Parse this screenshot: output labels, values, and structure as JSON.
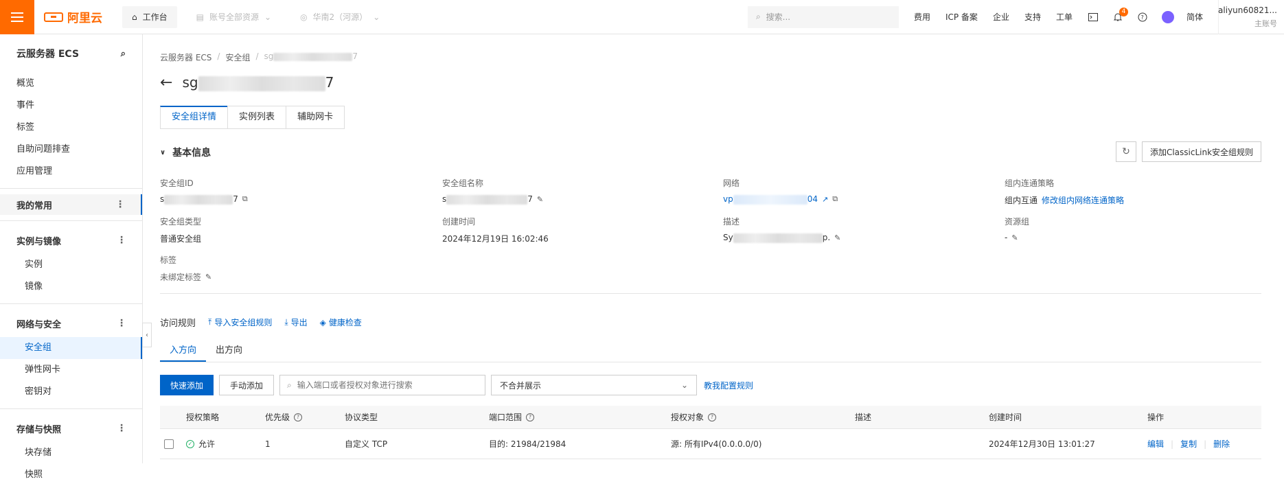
{
  "topbar": {
    "logo_text": "阿里云",
    "workbench": "工作台",
    "account_resources": "账号全部资源",
    "region": "华南2（河源）",
    "search_placeholder": "搜索...",
    "links": [
      "费用",
      "ICP 备案",
      "企业",
      "支持",
      "工单"
    ],
    "notification_count": "4",
    "lang": "简体",
    "account_name": "aliyun60821...",
    "account_role": "主账号"
  },
  "sidebar": {
    "title": "云服务器 ECS",
    "items_top": [
      "概览",
      "事件",
      "标签",
      "自助问题排查",
      "应用管理"
    ],
    "mine": "我的常用",
    "groups": [
      {
        "label": "实例与镜像",
        "items": [
          "实例",
          "镜像"
        ]
      },
      {
        "label": "网络与安全",
        "items": [
          "安全组",
          "弹性网卡",
          "密钥对"
        ]
      },
      {
        "label": "存储与快照",
        "items": [
          "块存储",
          "快照"
        ]
      }
    ]
  },
  "breadcrumb": {
    "a": "云服务器 ECS",
    "b": "安全组",
    "c_prefix": "sg",
    "c_suffix": "7"
  },
  "page_title": {
    "prefix": "sg",
    "suffix": "7"
  },
  "tabs": [
    "安全组详情",
    "实例列表",
    "辅助网卡"
  ],
  "basic_info": {
    "heading": "基本信息",
    "classic_btn": "添加ClassicLink安全组规则",
    "fields": {
      "sg_id": {
        "label": "安全组ID",
        "prefix": "s",
        "suffix": "7"
      },
      "sg_name": {
        "label": "安全组名称",
        "prefix": "s",
        "suffix": "7"
      },
      "network": {
        "label": "网络",
        "prefix": "vp",
        "suffix": "04"
      },
      "intra_policy": {
        "label": "组内连通策略",
        "value": "组内互通",
        "action": "修改组内网络连通策略"
      },
      "sg_type": {
        "label": "安全组类型",
        "value": "普通安全组"
      },
      "created": {
        "label": "创建时间",
        "value": "2024年12月19日 16:02:46"
      },
      "desc": {
        "label": "描述",
        "prefix": "Sy",
        "suffix": "p."
      },
      "res_group": {
        "label": "资源组",
        "value": "-"
      },
      "tags": {
        "label": "标签",
        "value": "未绑定标签"
      }
    }
  },
  "rules": {
    "title": "访问规则",
    "import": "导入安全组规则",
    "export": "导出",
    "health": "健康检查",
    "dir_in": "入方向",
    "dir_out": "出方向",
    "quick_add": "快速添加",
    "manual_add": "手动添加",
    "search_placeholder": "输入端口或者授权对象进行搜索",
    "merge_select": "不合并展示",
    "teach": "教我配置规则",
    "columns": [
      "授权策略",
      "优先级",
      "协议类型",
      "端口范围",
      "授权对象",
      "描述",
      "创建时间",
      "操作"
    ],
    "rows": [
      {
        "policy": "允许",
        "priority": "1",
        "protocol": "自定义 TCP",
        "ports": "目的: 21984/21984",
        "object": "源: 所有IPv4(0.0.0.0/0)",
        "desc": "",
        "created": "2024年12月30日 13:01:27",
        "ops": [
          "编辑",
          "复制",
          "删除"
        ]
      }
    ]
  },
  "colors": {
    "accent": "#0064c8",
    "brand": "#ff6a00",
    "success": "#23b066"
  }
}
